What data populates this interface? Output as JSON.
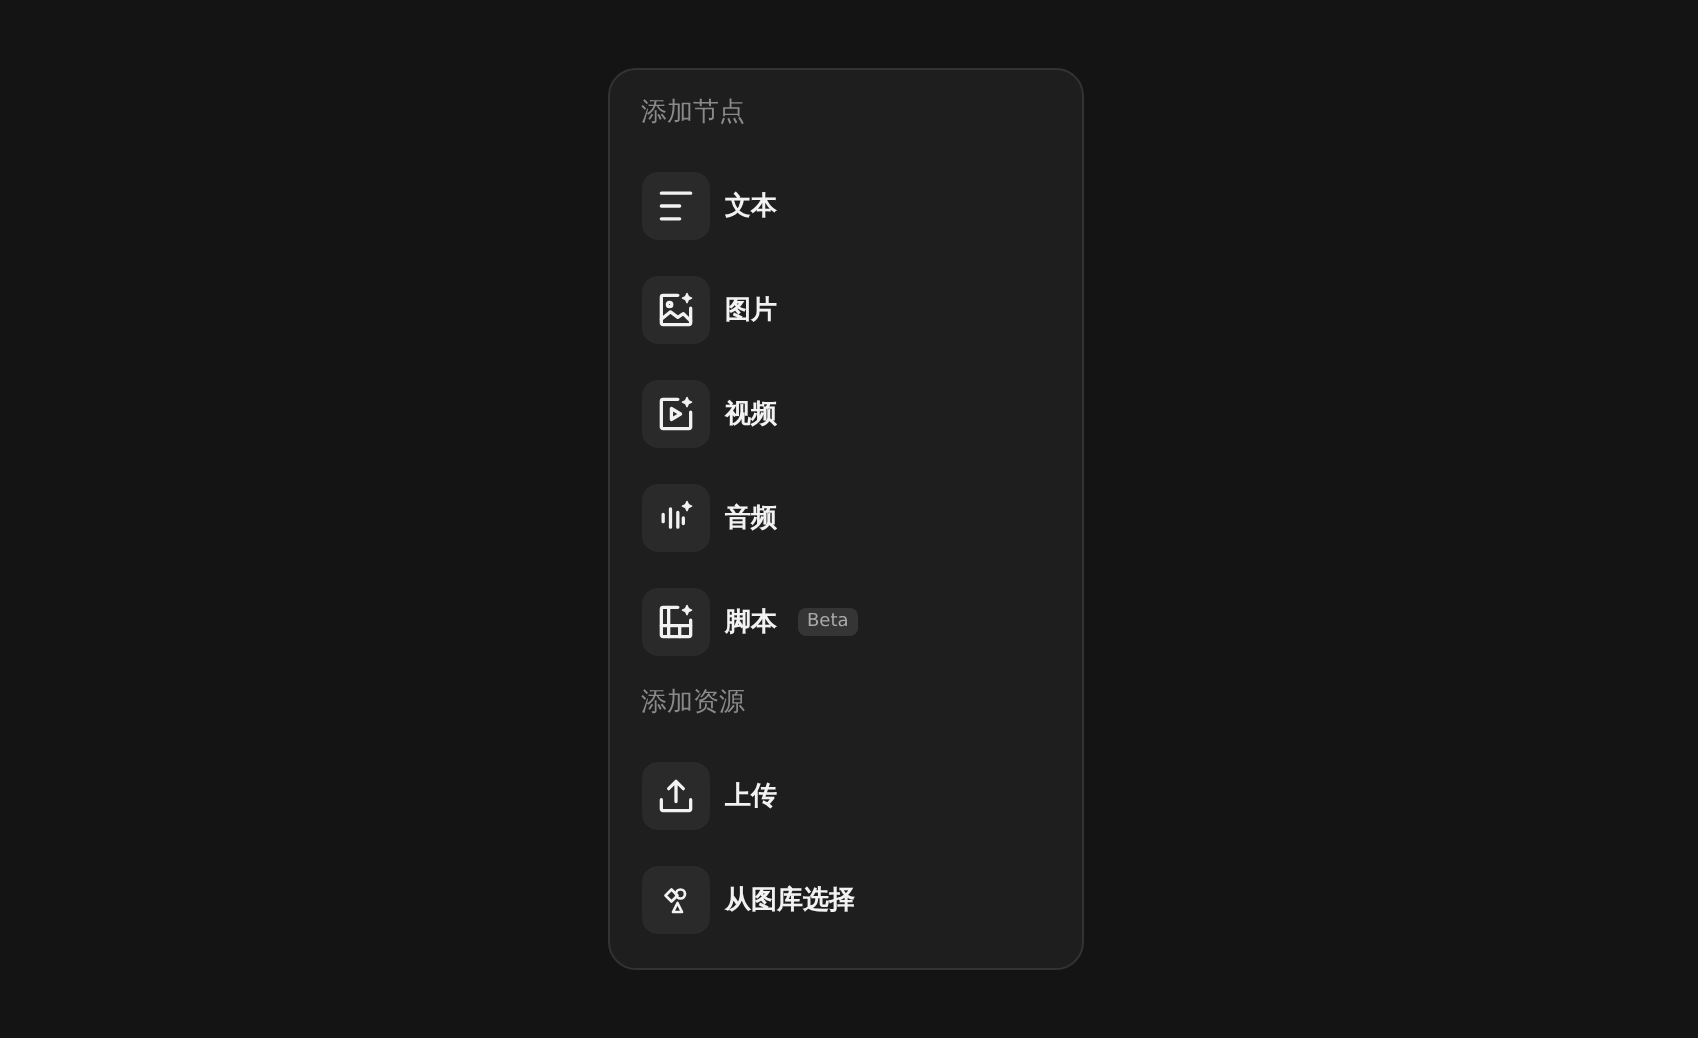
{
  "sections": [
    {
      "title": "添加节点",
      "items": [
        {
          "kind": "text",
          "label": "文本"
        },
        {
          "kind": "image",
          "label": "图片"
        },
        {
          "kind": "video",
          "label": "视频"
        },
        {
          "kind": "audio",
          "label": "音频"
        },
        {
          "kind": "script",
          "label": "脚本",
          "badge": "Beta"
        }
      ]
    },
    {
      "title": "添加资源",
      "items": [
        {
          "kind": "upload",
          "label": "上传"
        },
        {
          "kind": "library",
          "label": "从图库选择"
        }
      ]
    }
  ]
}
